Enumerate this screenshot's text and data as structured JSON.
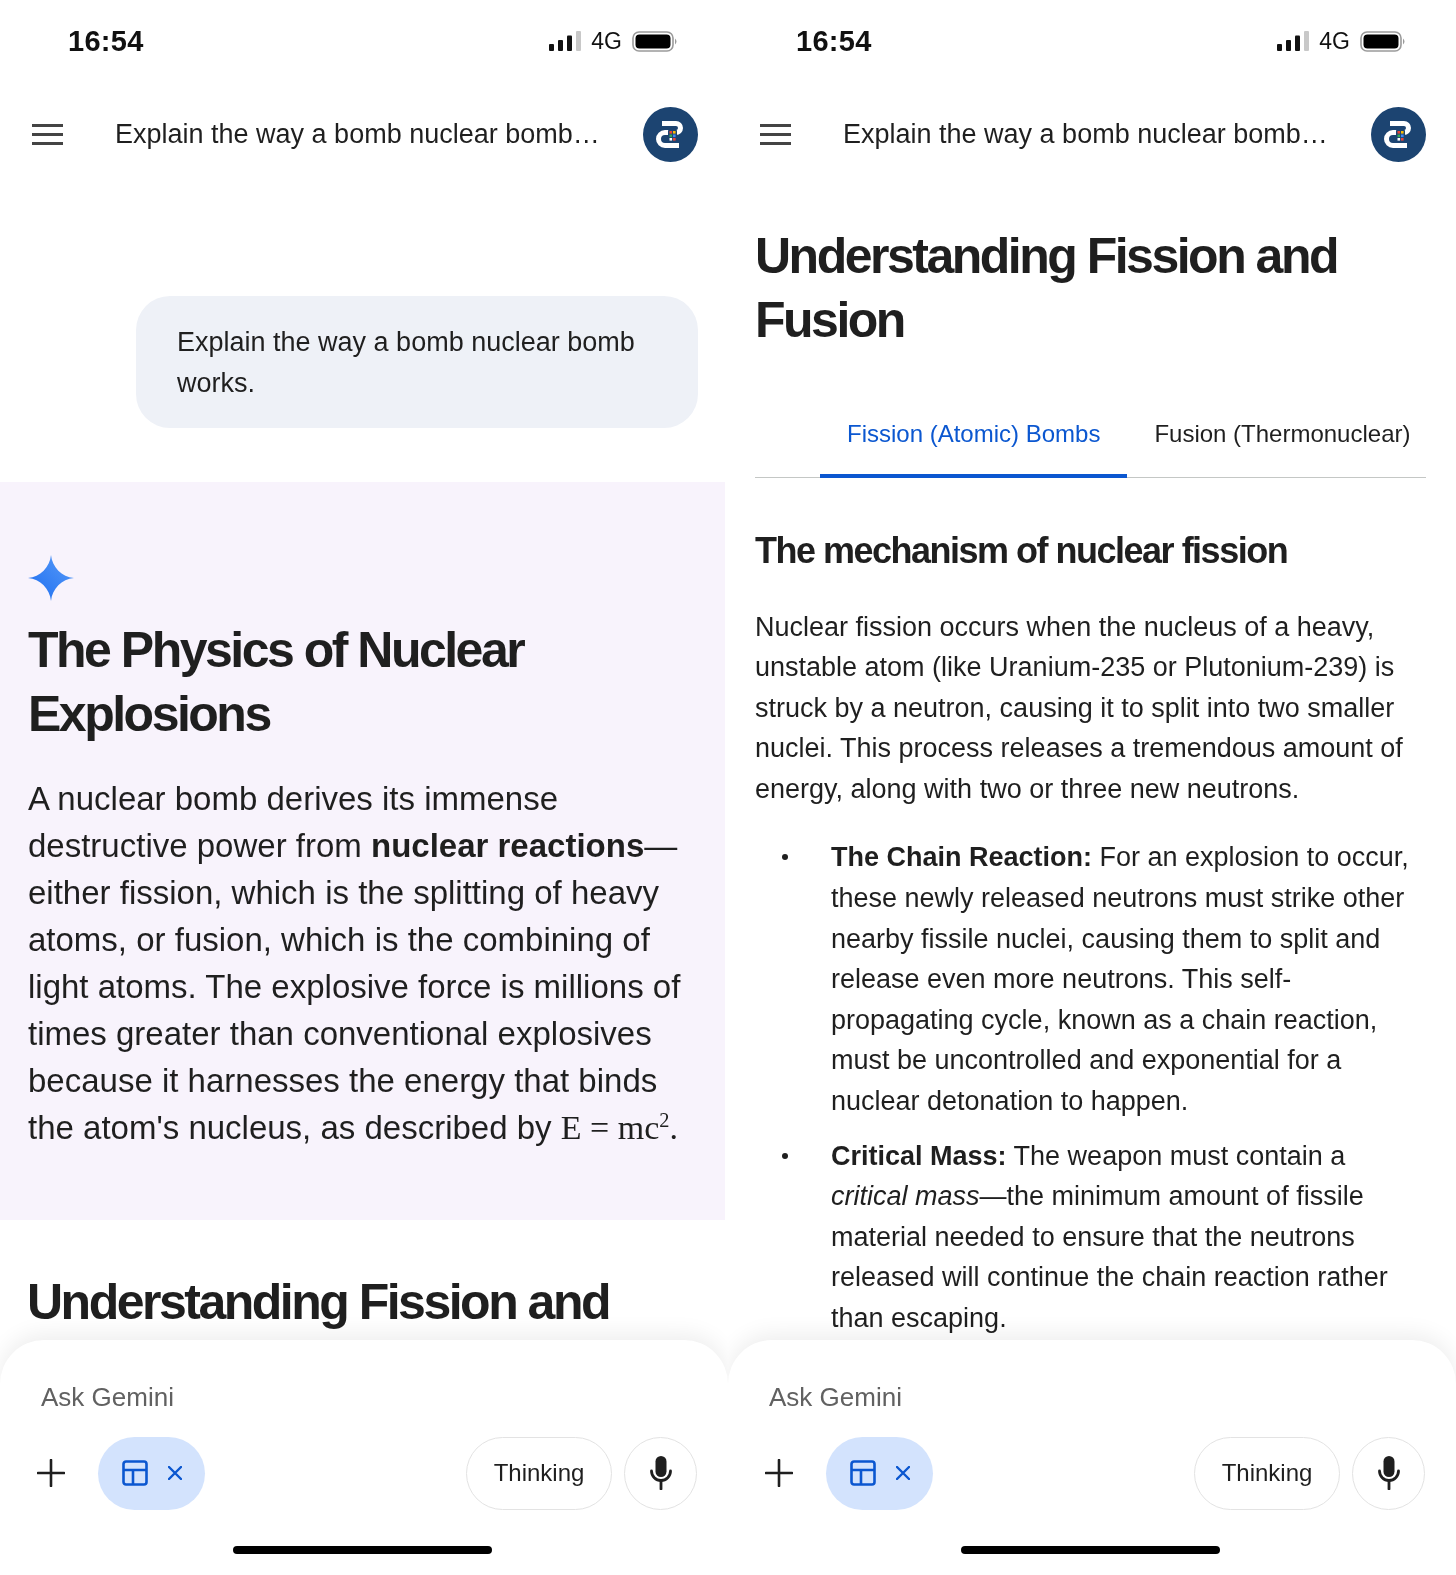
{
  "panels": [
    {
      "status_bar": {
        "time": "16:54",
        "network": "4G"
      },
      "top_bar": {
        "title": "Explain the way a bomb nuclear bomb…"
      },
      "content": [
        {
          "kind": "user_message",
          "text": "Explain the way a bomb nuclear bomb works."
        },
        {
          "kind": "response",
          "heading": "The Physics of Nuclear Explosions",
          "text": "A nuclear bomb derives its immense destructive power from **nuclear reactions**—either fission, which is the splitting of heavy atoms, or fusion, which is the combining of light atoms. The explosive force is millions of times greater than conventional explosives because it harnesses the energy that binds the atom's nucleus, as described by",
          "formula": "E = mc$^{2}$."
        },
        {
          "kind": "heading",
          "text": "Understanding Fission and"
        }
      ],
      "composer": {
        "placeholder": "Ask Gemini",
        "mode": "Thinking"
      }
    },
    {
      "status_bar": {
        "time": "16:54",
        "network": "4G"
      },
      "top_bar": {
        "title": "Explain the way a bomb nuclear bomb…"
      },
      "content": [
        {
          "kind": "heading",
          "text": "Understanding Fission and Fusion"
        },
        {
          "kind": "tabs",
          "tabs": [
            {
              "label": "Fission (Atomic) Bombs",
              "selected": true
            },
            {
              "label": "Fusion (Thermonuclear)",
              "selected": false
            }
          ]
        },
        {
          "kind": "subheading",
          "text": "The mechanism of nuclear fission"
        },
        {
          "kind": "paragraph",
          "text": "Nuclear fission occurs when the nucleus of a heavy, unstable atom (like Uranium-235 or Plutonium-239) is struck by a neutron, causing it to split into two smaller nuclei. This process releases a tremendous amount of energy, along with two or three new neutrons."
        },
        {
          "kind": "bullets",
          "items": [
            "**The Chain Reaction:** For an explosion to occur, these newly released neutrons must strike other nearby fissile nuclei, causing them to split and release even more neutrons. This self-propagating cycle, known as a chain reaction, must be uncontrolled and exponential for a nuclear detonation to happen.",
            "**Critical Mass:** The weapon must contain a *critical mass*—the minimum amount of fissile material needed to ensure that the neutrons released will continue the chain reaction rather than escaping."
          ]
        }
      ],
      "composer": {
        "placeholder": "Ask Gemini",
        "mode": "Thinking"
      }
    }
  ]
}
